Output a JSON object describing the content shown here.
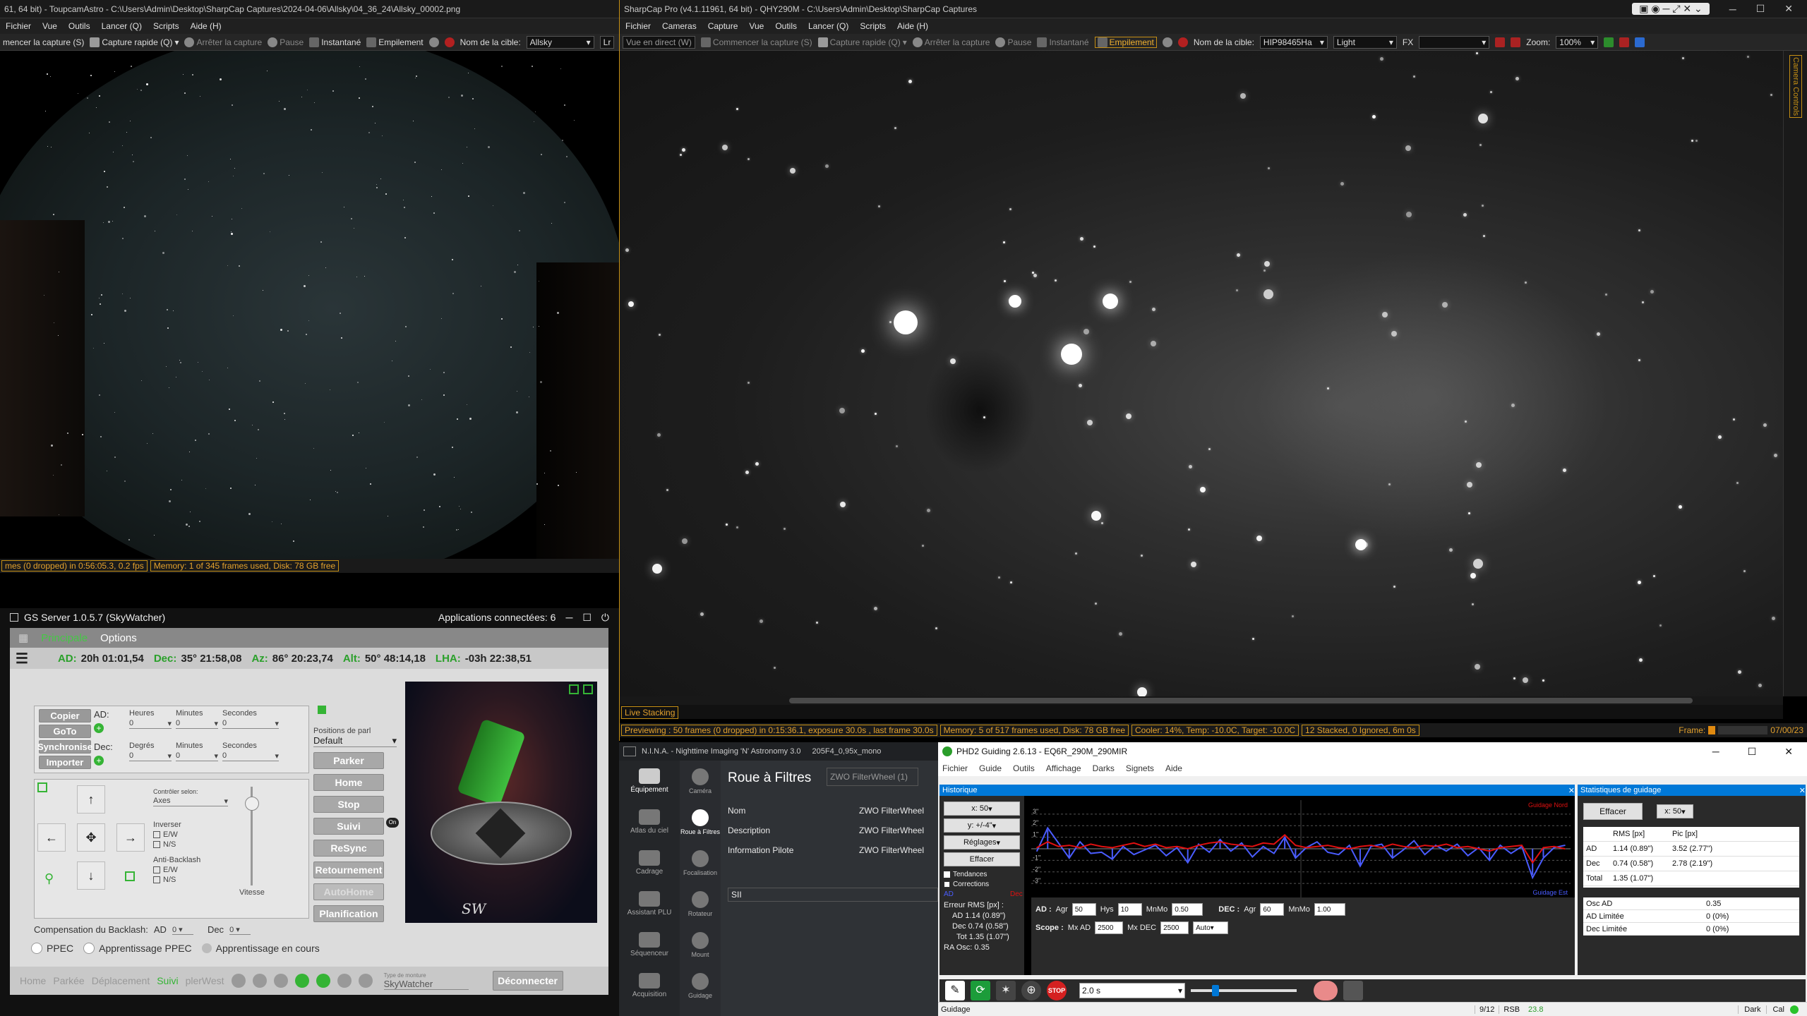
{
  "allsky": {
    "title": "61, 64 bit) - ToupcamAstro - C:\\Users\\Admin\\Desktop\\SharpCap Captures\\2024-04-06\\Allsky\\04_36_24\\Allsky_00002.png",
    "menu": [
      "Fichier",
      "Vue",
      "Outils",
      "Lancer (Q)",
      "Scripts",
      "Aide (H)"
    ],
    "toolbar": {
      "start": "mencer la capture (S)",
      "quick": "Capture rapide (Q)",
      "stop": "Arrêter la capture",
      "pause": "Pause",
      "snapshot": "Instantané",
      "stack": "Empilement",
      "target_label": "Nom de la cible:",
      "target_value": "Allsky",
      "extra": "Lr"
    },
    "status": {
      "frames": "mes (0 dropped) in 0:56:05.3, 0.2 fps",
      "memory": "Memory: 1 of 345 frames used, Disk: 78 GB free"
    }
  },
  "sharpcap": {
    "title": "SharpCap Pro (v4.1.11961, 64 bit) - QHY290M - C:\\Users\\Admin\\Desktop\\SharpCap Captures",
    "menu": [
      "Fichier",
      "Cameras",
      "Capture",
      "Vue",
      "Outils",
      "Lancer (Q)",
      "Scripts",
      "Aide (H)"
    ],
    "toolbar": {
      "live": "Vue en direct (W)",
      "start": "Commencer la capture (S)",
      "quick": "Capture rapide (Q)",
      "stop": "Arrêter la capture",
      "pause": "Pause",
      "snapshot": "Instantané",
      "stack": "Empilement",
      "target_label": "Nom de la cible:",
      "target_value": "HIP98465Ha",
      "frame_type": "Light",
      "fx_label": "FX",
      "zoom_label": "Zoom:",
      "zoom_value": "100%"
    },
    "side_tab": "Camera Controls",
    "live_stacking_tab": "Live Stacking",
    "status": {
      "preview": "Previewing : 50 frames (0 dropped) in 0:15:36.1, exposure 30.0s , last frame 30.0s",
      "memory": "Memory: 5 of 517 frames used, Disk: 78 GB free",
      "cooler": "Cooler: 14%, Temp: -10.0C, Target: -10.0C",
      "stack": "12 Stacked, 0 Ignored, 6m 0s",
      "frame_label": "Frame:",
      "frame_value": "07/00/23"
    }
  },
  "gss": {
    "title": "GS Server 1.0.5.7 (SkyWatcher)",
    "apps": "Applications connectées: 6",
    "tabs": [
      "Principale",
      "Options"
    ],
    "coords": {
      "ad_label": "AD:",
      "ad": "20h 01:01,54",
      "dec_label": "Dec:",
      "dec": "35° 21:58,08",
      "az_label": "Az:",
      "az": "86° 20:23,74",
      "alt_label": "Alt:",
      "alt": "50° 48:14,18",
      "lha_label": "LHA:",
      "lha": "-03h 22:38,51"
    },
    "left_buttons": [
      "Copier",
      "GoTo",
      "Synchronise",
      "Importer"
    ],
    "ad_row_label": "AD:",
    "dec_row_label": "Dec:",
    "col_heures": "Heures",
    "col_minutes": "Minutes",
    "col_secondes": "Secondes",
    "col_degres": "Degrés",
    "col_minutes2": "Minutes",
    "col_secondes2": "Secondes",
    "zero": "0",
    "park_positions_label": "Positions de parl",
    "park_positions_value": "Default",
    "right_buttons": [
      "Parker",
      "Home",
      "Stop",
      "Suivi",
      "ReSync",
      "Retournement",
      "AutoHome",
      "Planification"
    ],
    "suivi_badge": "On",
    "control_label": "Contrôler selon:",
    "control_value": "Axes",
    "inverser": "Inverser",
    "ew": "E/W",
    "ns": "N/S",
    "anti_backlash": "Anti-Backlash",
    "vitesse": "Vitesse",
    "backlash_label": "Compensation du Backlash:",
    "backlash_ad": "AD",
    "backlash_ad_val": "0",
    "backlash_dec": "Dec",
    "backlash_dec_val": "0",
    "ppec": "PPEC",
    "ppec_learning": "Apprentissage PPEC",
    "learning_running": "Apprentissage en cours",
    "bottom_status": [
      "Home",
      "Parkée",
      "Déplacement",
      "Suivi",
      "plerWest"
    ],
    "mount_type_label": "Type de monture",
    "mount_type": "SkyWatcher",
    "disconnect": "Déconnecter",
    "sw_label": "SW"
  },
  "nina": {
    "title": "N.I.N.A. - Nighttime Imaging 'N' Astronomy 3.0",
    "profile": "205F4_0,95x_mono",
    "sidebar": [
      "Équipement",
      "Atlas du ciel",
      "Cadrage",
      "Assistant PLU",
      "Séquenceur",
      "Acquisition"
    ],
    "subnav": [
      "Caméra",
      "Roue à Filtres",
      "Focalisation",
      "Rotateur",
      "Mount",
      "Guidage"
    ],
    "heading": "Roue à Filtres",
    "device": "ZWO FilterWheel (1)",
    "rows": [
      {
        "label": "Nom",
        "value": "ZWO FilterWheel"
      },
      {
        "label": "Description",
        "value": "ZWO FilterWheel"
      },
      {
        "label": "Information Pilote",
        "value": "ZWO FilterWheel"
      }
    ],
    "filter": "SII"
  },
  "phd2": {
    "title": "PHD2 Guiding 2.6.13 - EQ6R_290M_290MIR",
    "menu": [
      "Fichier",
      "Guide",
      "Outils",
      "Affichage",
      "Darks",
      "Signets",
      "Aide"
    ],
    "history_title": "Historique",
    "stats_title": "Statistiques de guidage",
    "x_scale": "x: 50",
    "y_scale": "y: +/-4\"",
    "settings": "Réglages",
    "clear": "Effacer",
    "trends": "Tendances",
    "corrections": "Corrections",
    "legend_ad": "AD",
    "legend_dec": "Dec",
    "rms_title": "Erreur RMS [px] :",
    "rms_ad": "AD 1.14 (0.89\")",
    "rms_dec": "Dec 0.74 (0.58\")",
    "rms_tot": "Tot 1.35 (1.07\")",
    "ra_osc": "RA Osc: 0.35",
    "guide_north": "Guidage Nord",
    "guide_east": "Guidage Est",
    "y_ticks": [
      "3\"",
      "2\"",
      "1\"",
      "-1\"",
      "-2\"",
      "-3\""
    ],
    "ad_ctrl": {
      "label": "AD :",
      "agr": "Agr",
      "agr_val": "50",
      "hys": "Hys",
      "hys_val": "10",
      "mnmo": "MnMo",
      "mnmo_val": "0.50"
    },
    "dec_ctrl": {
      "label": "DEC :",
      "agr": "Agr",
      "agr_val": "60",
      "mnmo": "MnMo",
      "mnmo_val": "1.00"
    },
    "scope": {
      "label": "Scope :",
      "mxad": "Mx AD",
      "mxad_val": "2500",
      "mxdec": "Mx DEC",
      "mxdec_val": "2500",
      "mode": "Auto"
    },
    "stats": {
      "clear": "Effacer",
      "x_scale": "x: 50",
      "headers": [
        "",
        "RMS [px]",
        "Pic [px]"
      ],
      "rows": [
        [
          "AD",
          "1.14 (0.89\")",
          "3.52 (2.77\")"
        ],
        [
          "Dec",
          "0.74 (0.58\")",
          "2.78 (2.19\")"
        ],
        [
          "Total",
          "1.35 (1.07\")",
          ""
        ]
      ],
      "extra": [
        [
          "Osc AD",
          "0.35"
        ],
        [
          "AD Limitée",
          "0 (0%)"
        ],
        [
          "Dec Limitée",
          "0 (0%)"
        ]
      ]
    },
    "exposure": "2.0 s",
    "stop": "STOP",
    "statusbar": {
      "state": "Guidage",
      "count": "9/12",
      "rsb": "RSB",
      "snr": "23.8",
      "dark": "Dark",
      "cal": "Cal"
    }
  },
  "colors": {
    "accent_orange": "#c58f14",
    "gss_green": "#35b435",
    "phd_blue": "#0078d7",
    "ra_line": "#4a5cff",
    "dec_line": "#e01010"
  },
  "chart_data": {
    "type": "line",
    "x": [
      0,
      1,
      2,
      3,
      4,
      5,
      6,
      7,
      8,
      9,
      10,
      11,
      12,
      13,
      14,
      15,
      16,
      17,
      18,
      19,
      20,
      21,
      22,
      23,
      24,
      25,
      26,
      27,
      28,
      29,
      30,
      31,
      32,
      33,
      34,
      35,
      36,
      37,
      38,
      39,
      40,
      41,
      42,
      43,
      44,
      45,
      46,
      47,
      48,
      49
    ],
    "series": [
      {
        "name": "AD",
        "values": [
          -0.2,
          1.8,
          0.5,
          -0.8,
          0.6,
          -0.4,
          -0.3,
          -0.9,
          0.2,
          -0.5,
          -0.1,
          0.3,
          -0.6,
          0.1,
          -1.2,
          0.4,
          -0.3,
          0.8,
          -0.2,
          0.5,
          -0.7,
          0.2,
          -0.4,
          1.0,
          -0.8,
          0.1,
          0.6,
          -0.3,
          -0.5,
          0.3,
          -1.5,
          0.2,
          0.4,
          -0.8,
          -0.1,
          0.7,
          -0.5,
          0.3,
          -0.2,
          0.4,
          -0.6,
          0.1,
          -1.0,
          0.3,
          -0.4,
          0.2,
          -2.5,
          -0.8,
          0.1,
          0.3
        ]
      },
      {
        "name": "Dec",
        "values": [
          0.1,
          0.6,
          0.2,
          0.3,
          0.1,
          0.4,
          0.2,
          0.1,
          0.3,
          0.5,
          0.2,
          0.4,
          0.1,
          0.2,
          0.0,
          0.3,
          0.5,
          0.6,
          0.4,
          0.3,
          0.2,
          0.5,
          0.4,
          1.2,
          0.3,
          0.1,
          0.2,
          0.3,
          0.1,
          0.0,
          0.2,
          0.3,
          0.1,
          0.4,
          0.2,
          0.1,
          0.3,
          0.2,
          0.4,
          0.1,
          0.2,
          0.0,
          -0.2,
          0.1,
          0.2,
          0.3,
          -1.2,
          0.1,
          0.2,
          0.0
        ]
      }
    ],
    "ylim": [
      -4,
      4
    ],
    "ylabel": "",
    "grid": true
  }
}
